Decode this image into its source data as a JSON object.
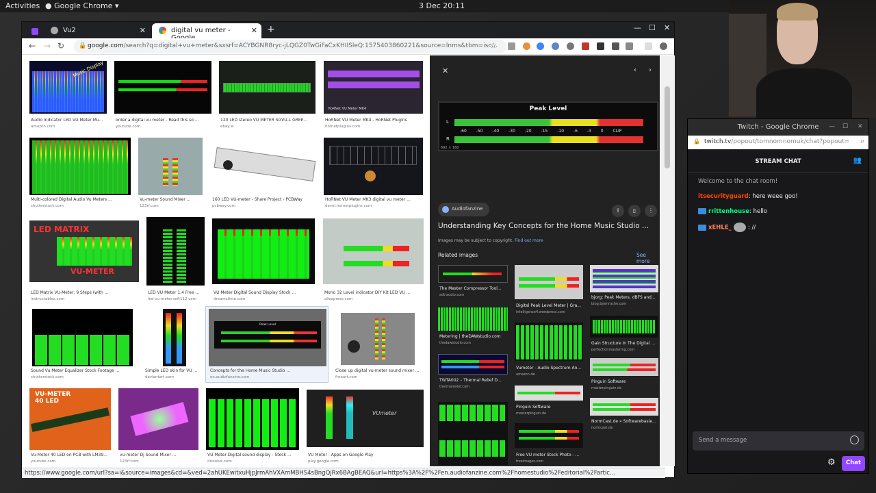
{
  "system_bar": {
    "activities": "Activities",
    "app_menu": "Google Chrome",
    "clock": "3 Dec  20:11"
  },
  "chrome": {
    "tabs": [
      {
        "label": "Vu2",
        "active": false
      },
      {
        "label": "digital vu meter - Google",
        "active": true
      }
    ],
    "url_main": "google.com",
    "url_rest": "/search?q=digital+vu+meter&sxsrf=ACYBGNR8ryc-jLQGZ0TwGiFaCxKHIISleQ:1575403860221&source=lnms&tbm=isc...",
    "status_url": "https://www.google.com/url?sa=i&source=images&cd=&ved=2ahUKEwitxuHjpJrmAhVXAmMBHS4sBngQjRx6BAgBEAQ&url=https%3A%2F%2Fen.audiofanzine.com%2Fhomestudio%2Feditorial%2Fartic..."
  },
  "results": [
    {
      "caption": "Audio Indicator LED VU Meter Mu...",
      "source": "amazon.com"
    },
    {
      "caption": "order a digital vu meter - Read this so ...",
      "source": "youtube.com"
    },
    {
      "caption": "120 LED stereo VU METER SGVU-L GREE...",
      "source": "ebay.ie"
    },
    {
      "caption": "HoRNet VU Meter MK4 - HoRNet Plugins",
      "source": "hornetplugins.com"
    },
    {
      "caption": "Multi-colored Digital Audio Vu Meters ...",
      "source": "shutterstock.com"
    },
    {
      "caption": "Vu-meter Sound Mixer ...",
      "source": "123rf.com"
    },
    {
      "caption": "160 LED VU-meter - Share Project - PCBWay",
      "source": "pcbway.com"
    },
    {
      "caption": "HoRNet VU Meter MK3 digital vu meter ...",
      "source": "devel.hornetplugins.com"
    },
    {
      "caption": "LED Matrix VU-Meter: 9 Steps (with ...",
      "source": "instructables.com"
    },
    {
      "caption": "LED VU Meter 1.4 Free ...",
      "source": "led-vu-meter.soft112.com"
    },
    {
      "caption": "VU Meter Digital Sound Display Stock ...",
      "source": "dreamstime.com"
    },
    {
      "caption": "Mono 32 Level indicator DIY Kit LED VU ...",
      "source": "aliexpress.com"
    },
    {
      "caption": "Sound Vu Meter Equalizer Stock Footage ...",
      "source": "shutterstock.com"
    },
    {
      "caption": "Simple LED skin for VU ...",
      "source": "deviantart.com"
    },
    {
      "caption": "Concepts for the Home Music Studio ...",
      "source": "en.audiofanzine.com"
    },
    {
      "caption": "Close up digital vu-meter sound mixer ...",
      "source": "freeart.com"
    },
    {
      "caption": "Vu-Meter 40 LED on PCB with LM39...",
      "source": "youtube.com"
    },
    {
      "caption": "vu-meter Dj Sound Mixer ...",
      "source": "123rf.com"
    },
    {
      "caption": "VU Meter Digital sound display - Stock ...",
      "source": "dissolve.com"
    },
    {
      "caption": "VU Meter - Apps on Google Play",
      "source": "play.google.com"
    }
  ],
  "thumb_text": {
    "music_display": "Music Display",
    "led_matrix": "LED MATRIX",
    "vu_meter": "VU-METER",
    "vu_meter_40": "VU-METER\n40 LED",
    "hornet": "HoRNet VU Meter MK4",
    "peak_level": "Peak Level",
    "vu_app": "VUmeter"
  },
  "panel": {
    "meter_title": "Peak Level",
    "meter_scale": "-60 -50 -40 -30 -20 -15 -10 -6 -3 0 CLIP",
    "left": "L",
    "right": "R",
    "dims": "692 × 160",
    "source_badge": "Audiofanzine",
    "title": "Understanding Key Concepts for the Home Music Studio ...",
    "copyright": "Images may be subject to copyright.",
    "find_out_more": "Find out more",
    "related_label": "Related images",
    "see_more": "See more",
    "related": [
      {
        "caption": "The Master Compressor Tool...",
        "source": "adt-audio.com"
      },
      {
        "caption": "Digital Peak Level Meter | Gra...",
        "source": "intelligence4.wordpress.com"
      },
      {
        "caption": "bjorg: Peak Meters, dBFS and...",
        "source": "blog.bjornroche.com"
      },
      {
        "caption": "Metering | theDAWstudio.com",
        "source": "thedawstudio.com"
      },
      {
        "caption": "Vumeter - Audio Spectrum An...",
        "source": "amazon.de"
      },
      {
        "caption": "Gain Structure In The Digital ...",
        "source": "perfectionmastering.com"
      },
      {
        "caption": "TWTA002 – Thermal Relief D...",
        "source": "thermalrelief.com"
      },
      {
        "caption": "Pinguin Software",
        "source": "masterpinguin.de"
      },
      {
        "caption": "Pinguin Software",
        "source": "masterpinguin.de"
      },
      {
        "caption": "Free VU meter Stock Photo - ...",
        "source": "freeimages.com"
      },
      {
        "caption": "NormCast.de » Softwarebasie...",
        "source": "normcast.de"
      }
    ]
  },
  "twitch": {
    "window_title": "Twitch - Google Chrome",
    "url_main": "twitch.tv",
    "url_rest": "/popout/tomnomnomuk/chat?popout=",
    "header": "STREAM CHAT",
    "welcome": "Welcome to the chat room!",
    "messages": [
      {
        "user": "itsecurityguard",
        "text": ": here weee goo!",
        "color": "#ff4500",
        "badge": false,
        "emote": false
      },
      {
        "user": "rrittenhouse",
        "text": ": hello",
        "color": "#00ff7f",
        "badge": true,
        "emote": false
      },
      {
        "user": "xEHLE_",
        "text": ": //",
        "color": "#ff7f50",
        "badge": true,
        "emote": true
      }
    ],
    "placeholder": "Send a message",
    "chat_button": "Chat"
  },
  "colors": {
    "accent": "#9147ff",
    "chrome_dark": "#202124",
    "panel_dark": "#222222",
    "link": "#8ab4f8"
  }
}
